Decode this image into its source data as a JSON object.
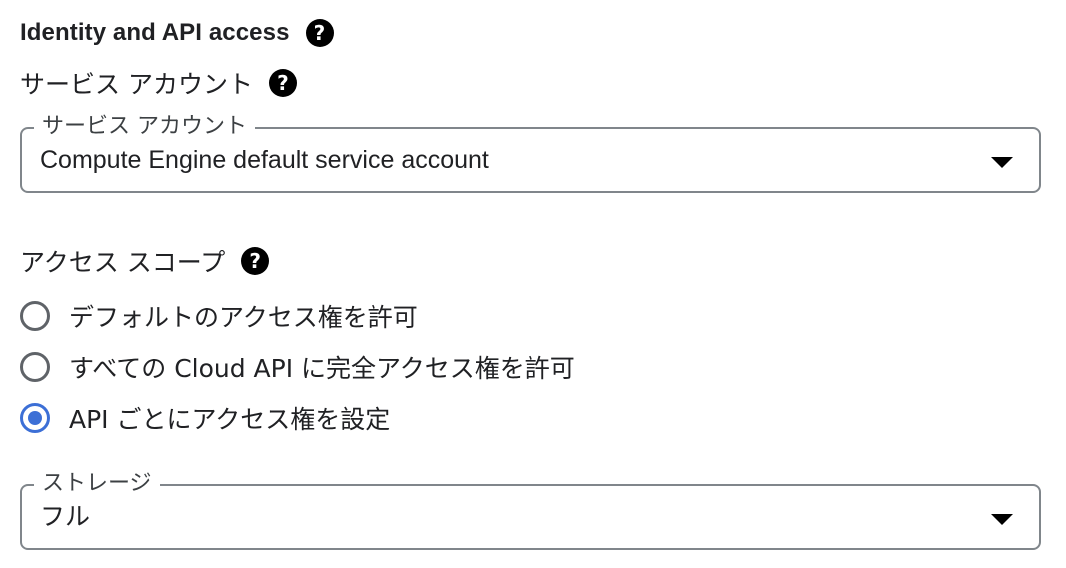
{
  "section": {
    "title": "Identity and API access",
    "help_icon": "help-icon"
  },
  "service_account": {
    "label": "サービス アカウント",
    "help_icon": "help-icon",
    "select": {
      "floating_label": "サービス アカウント",
      "value": "Compute Engine default service account",
      "icon": "dropdown-caret-icon"
    }
  },
  "access_scope": {
    "label": "アクセス スコープ",
    "help_icon": "help-icon",
    "options": [
      {
        "label": "デフォルトのアクセス権を許可",
        "selected": false
      },
      {
        "label": "すべての Cloud API に完全アクセス権を許可",
        "selected": false
      },
      {
        "label": "API ごとにアクセス権を設定",
        "selected": true
      }
    ]
  },
  "storage": {
    "select": {
      "floating_label": "ストレージ",
      "value": "フル",
      "icon": "dropdown-caret-icon"
    }
  },
  "colors": {
    "radio_selected": "#3c6fd6",
    "radio_unselected": "#5f6368",
    "outline": "#80868b",
    "text": "#202124"
  }
}
